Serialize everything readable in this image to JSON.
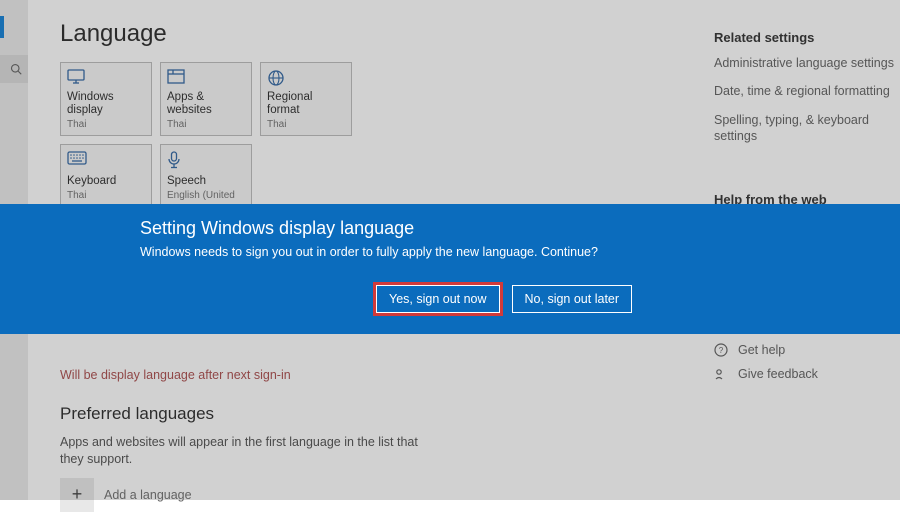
{
  "page": {
    "title": "Language"
  },
  "tiles": [
    {
      "label": "Windows display",
      "sub": "Thai",
      "icon": "monitor"
    },
    {
      "label": "Apps & websites",
      "sub": "Thai",
      "icon": "window"
    },
    {
      "label": "Regional format",
      "sub": "Thai",
      "icon": "globe"
    },
    {
      "label": "Keyboard",
      "sub": "Thai",
      "icon": "keyboard"
    },
    {
      "label": "Speech",
      "sub": "English (United",
      "icon": "mic"
    }
  ],
  "notice": "Will be display language after next sign-in",
  "preferred": {
    "heading": "Preferred languages",
    "desc": "Apps and websites will appear in the first language in the list that they support.",
    "add_label": "Add a language"
  },
  "aside": {
    "related_heading": "Related settings",
    "links": [
      "Administrative language settings",
      "Date, time & regional formatting",
      "Spelling, typing, & keyboard settings"
    ],
    "help_heading": "Help from the web",
    "get_help": "Get help",
    "give_feedback": "Give feedback"
  },
  "dialog": {
    "title": "Setting Windows display language",
    "message": "Windows needs to sign you out in order to fully apply the new language. Continue?",
    "yes_label": "Yes, sign out now",
    "no_label": "No, sign out later"
  }
}
